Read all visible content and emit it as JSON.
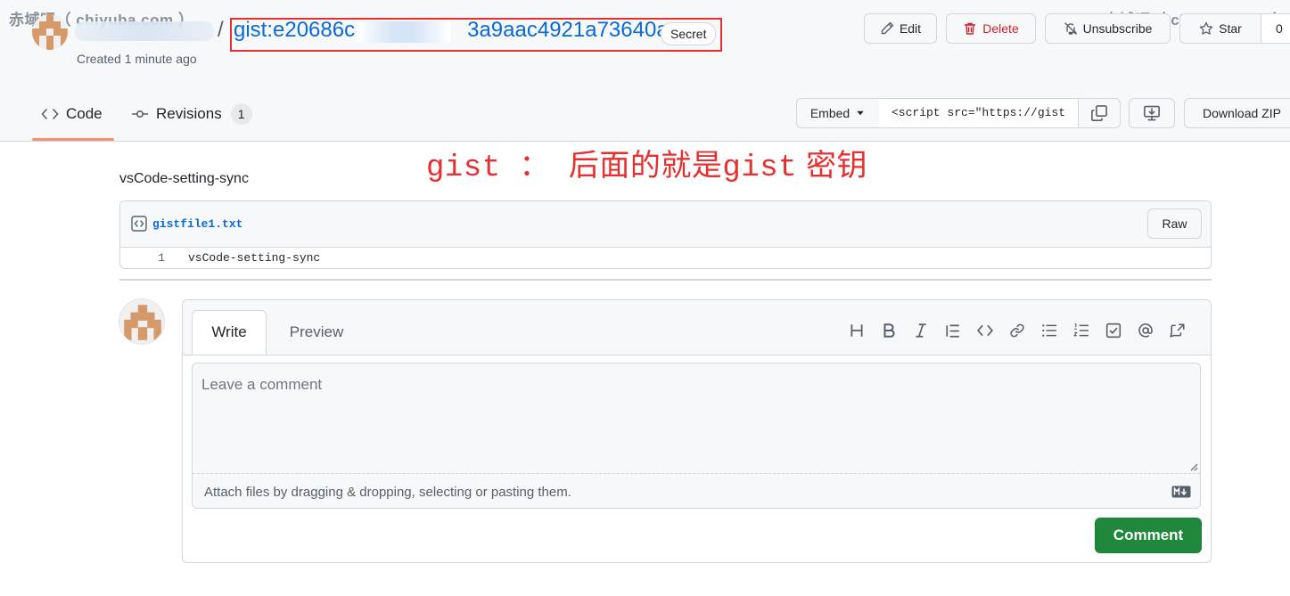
{
  "watermark": {
    "text": "赤域吧（ chiyuba.com ）"
  },
  "header": {
    "gist_id_visible_prefix": "gist:e20686c",
    "gist_id_visible_suffix": "3a9aac4921a73640a",
    "secret_label": "Secret",
    "created": "Created 1 minute ago",
    "separator": "/"
  },
  "actions": {
    "edit": "Edit",
    "delete": "Delete",
    "unsubscribe": "Unsubscribe",
    "star": "Star",
    "star_count": "0"
  },
  "tabs": {
    "code": "Code",
    "revisions": "Revisions",
    "revisions_count": "1"
  },
  "embed": {
    "label": "Embed",
    "value": "<script src=\"https://gist",
    "download_zip": "Download ZIP"
  },
  "annotation": {
    "part1": "gist ： ",
    "part2": "后面的就是",
    "part3": "gist",
    "part4": " 密钥"
  },
  "gist": {
    "description": "vsCode-setting-sync",
    "file_name": "gistfile1.txt",
    "raw_label": "Raw",
    "lines": [
      {
        "num": "1",
        "code": "vsCode-setting-sync"
      }
    ]
  },
  "comment": {
    "write_tab": "Write",
    "preview_tab": "Preview",
    "placeholder": "Leave a comment",
    "attach_text": "Attach files by dragging & dropping, selecting or pasting them.",
    "submit": "Comment"
  },
  "colors": {
    "link": "#0969da",
    "annotation_red": "#e5302f",
    "primary_green": "#1f883d",
    "danger": "#cf222e"
  }
}
